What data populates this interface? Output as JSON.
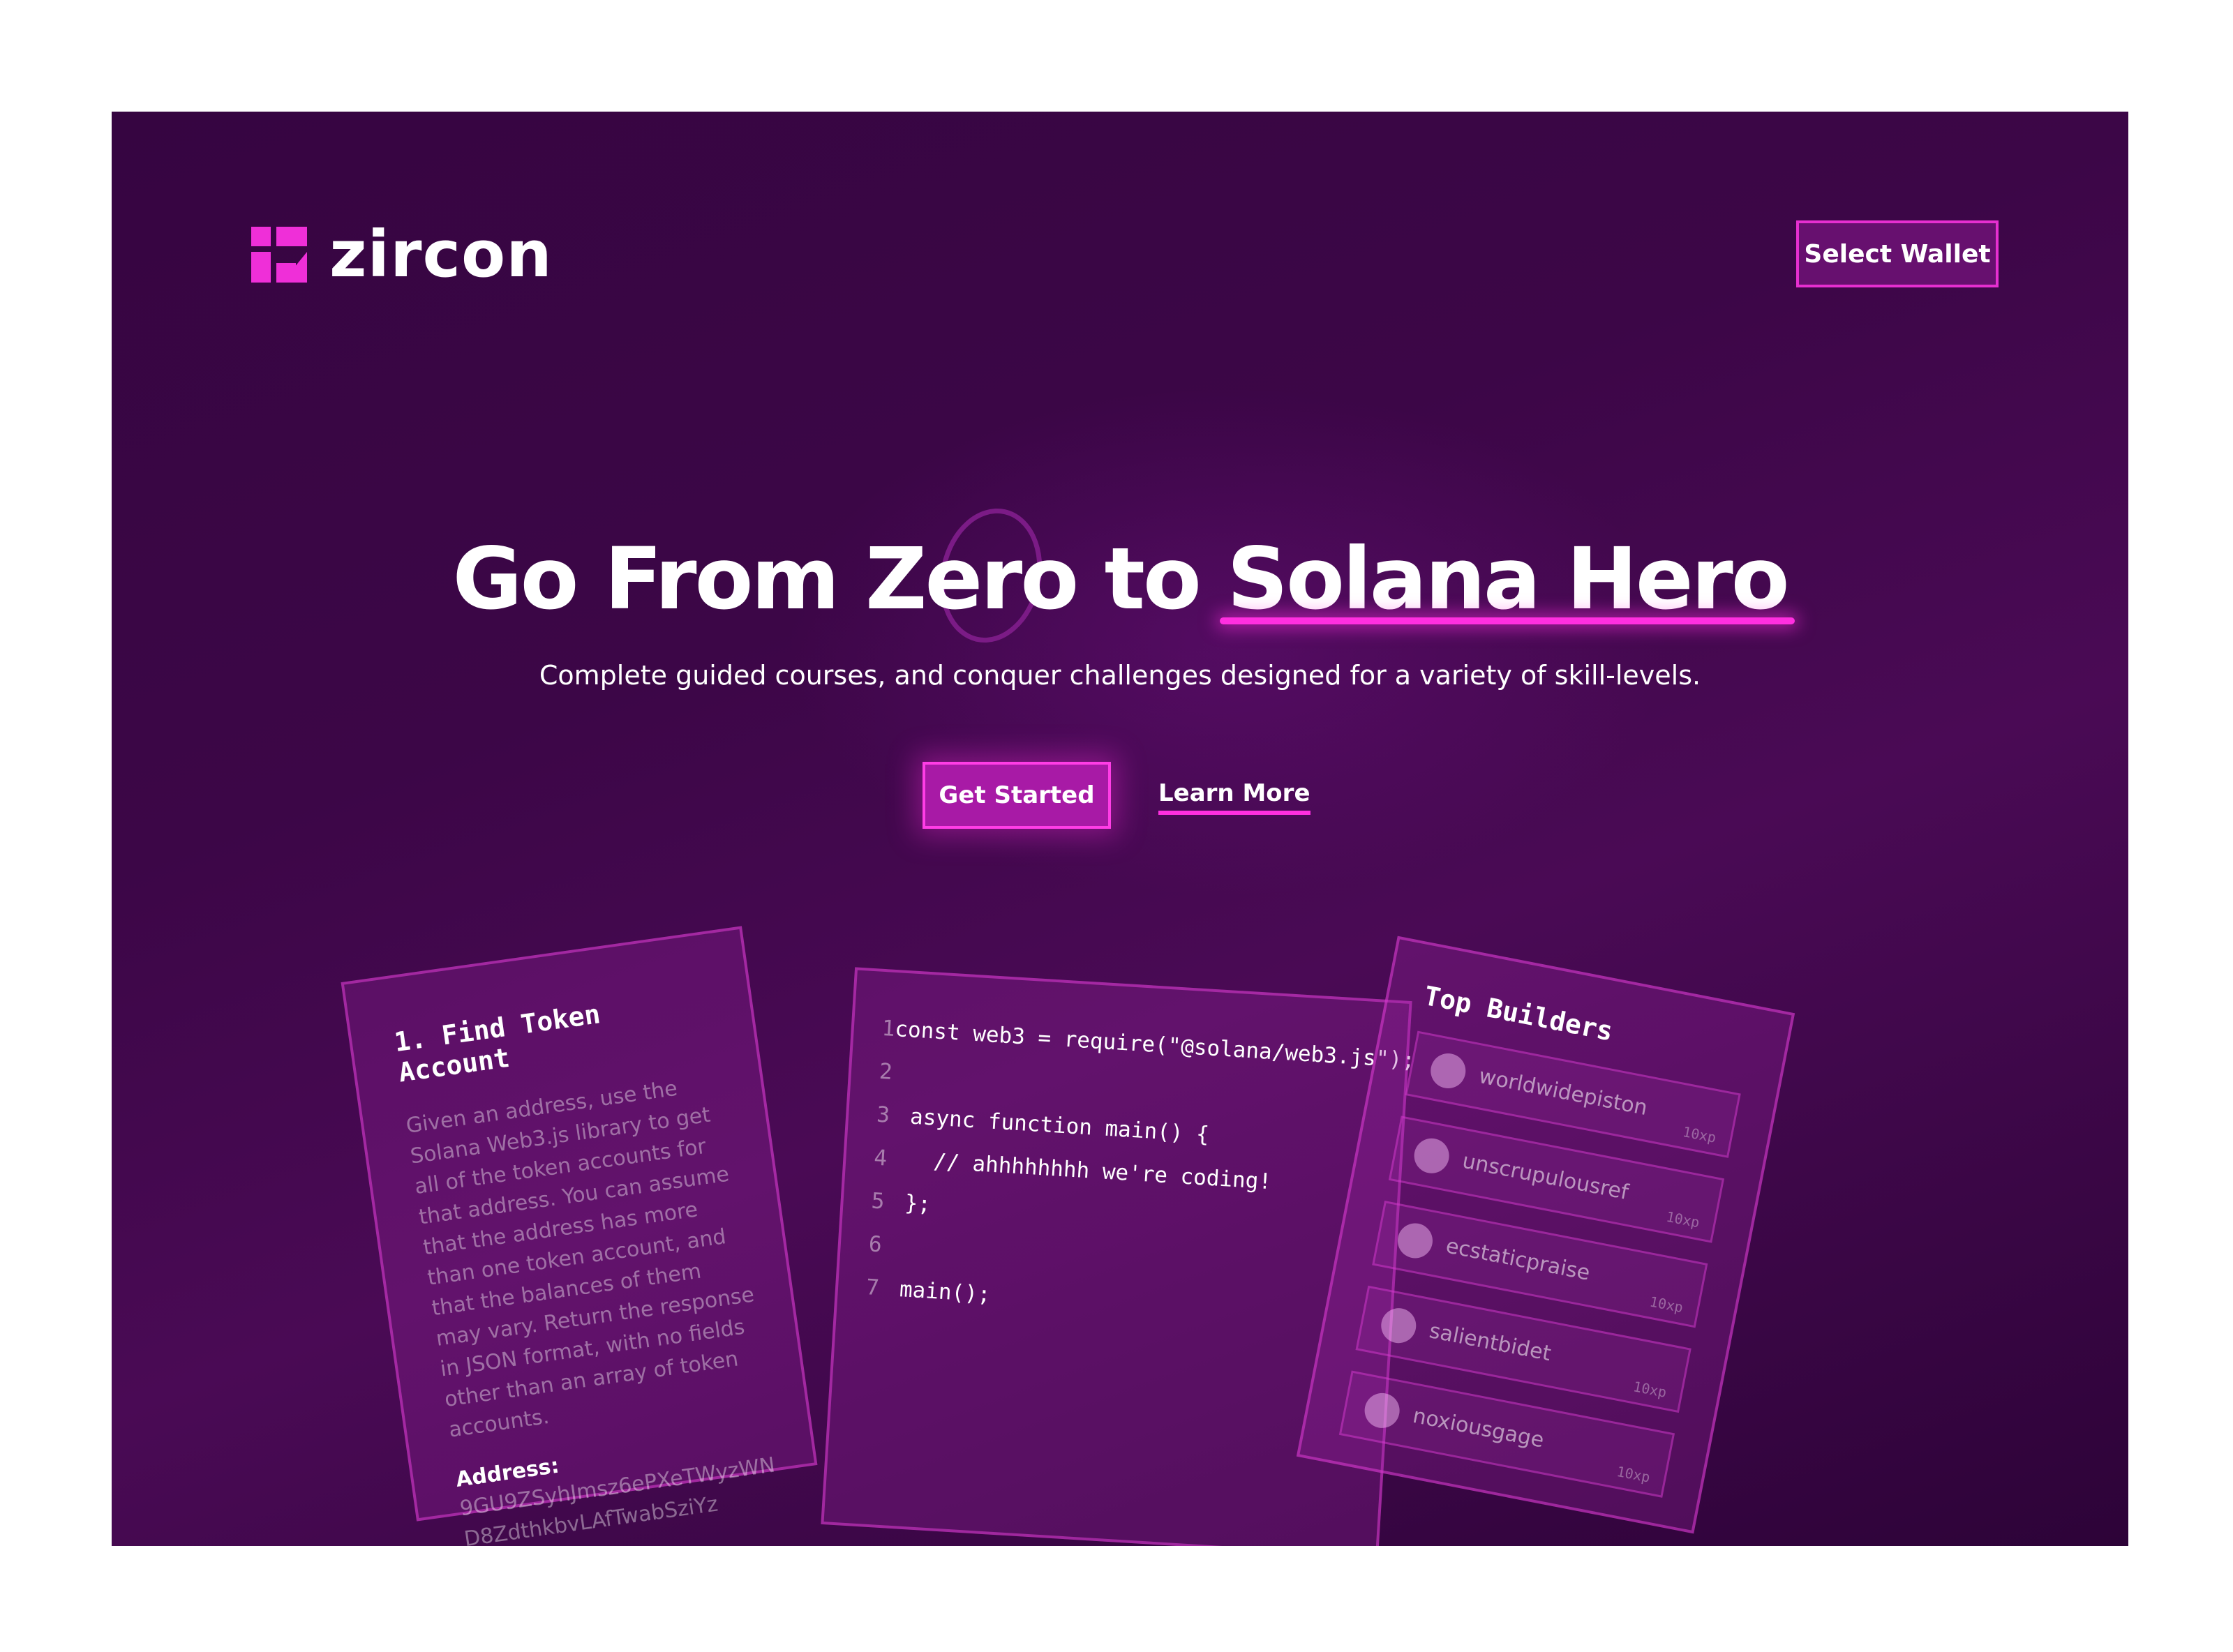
{
  "header": {
    "logo_text": "zircon",
    "wallet_button": "Select Wallet"
  },
  "hero": {
    "headline_part1": "Go From Zero to ",
    "headline_highlight": "Solana Hero",
    "subhead": "Complete guided courses, and conquer challenges designed for a variety of skill-levels.",
    "primary_cta": "Get Started",
    "secondary_cta": "Learn More"
  },
  "task_card": {
    "title": "1. Find Token Account",
    "body": "Given an address, use the Solana Web3.js library to get all of the token accounts for that address. You can assume that the address has more than one token account, and that the balances of them may vary. Return the response in JSON format, with no fields other than an array of token accounts.",
    "address_label": "Address:",
    "address": "9GU9ZSyhJmsz6ePXeTWyzWND8ZdthkbvLAfTwabSziYz"
  },
  "code_card": {
    "lines": [
      {
        "num": "1",
        "text": "const web3 = require(\"@solana/web3.js\");"
      },
      {
        "num": "2",
        "text": ""
      },
      {
        "num": "3",
        "text": "async function main() {"
      },
      {
        "num": "4",
        "text": "  // ahhhhhhhh we're coding!"
      },
      {
        "num": "5",
        "text": "};"
      },
      {
        "num": "6",
        "text": ""
      },
      {
        "num": "7",
        "text": "main();"
      }
    ]
  },
  "builders_card": {
    "title": "Top Builders",
    "builders": [
      {
        "name": "worldwidepiston",
        "xp": "10xp"
      },
      {
        "name": "unscrupulousref",
        "xp": "10xp"
      },
      {
        "name": "ecstaticpraise",
        "xp": "10xp"
      },
      {
        "name": "salientbidet",
        "xp": "10xp"
      },
      {
        "name": "noxiousgage",
        "xp": "10xp"
      }
    ]
  },
  "colors": {
    "background": "#3c0647",
    "accent": "#ef2fd8",
    "button_fill": "#a81aa6"
  }
}
